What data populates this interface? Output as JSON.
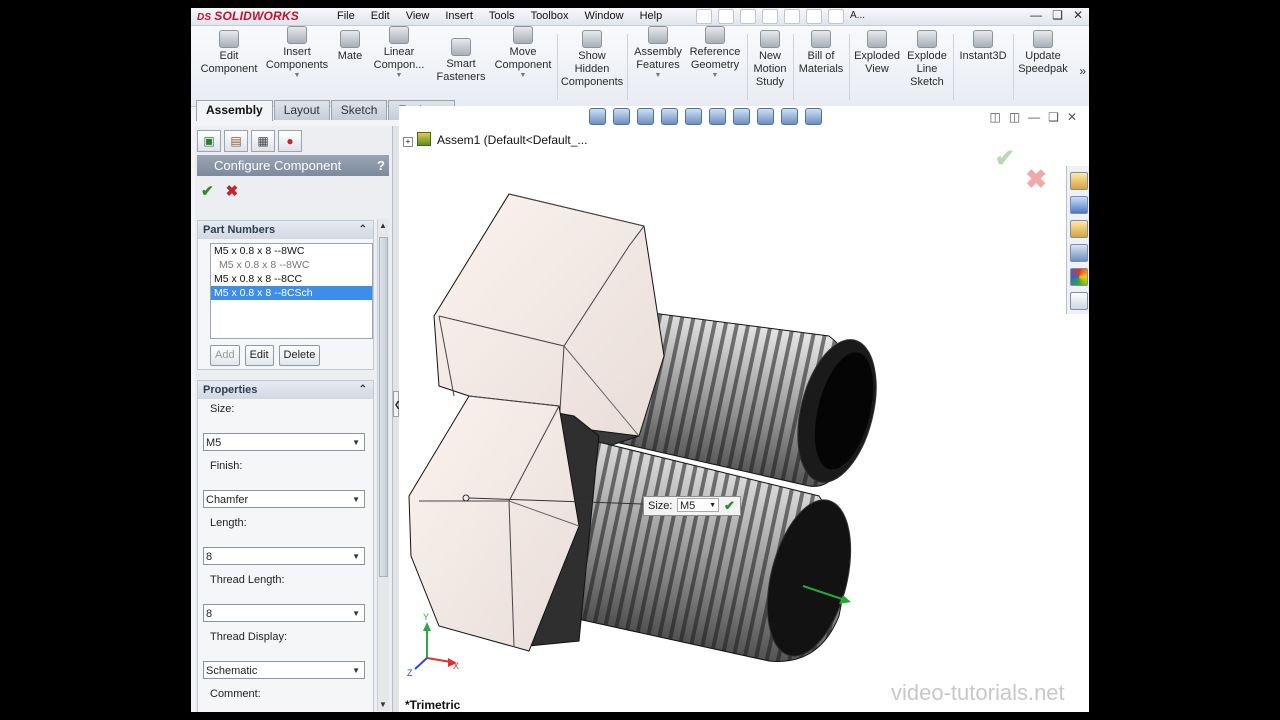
{
  "app": {
    "brand_prefix": "DS",
    "brand": "SOLIDWORKS"
  },
  "menu": [
    "File",
    "Edit",
    "View",
    "Insert",
    "Tools",
    "Toolbox",
    "Window",
    "Help"
  ],
  "search_hint": "A...",
  "commands": [
    {
      "l1": "Edit",
      "l2": "Component"
    },
    {
      "l1": "Insert",
      "l2": "Components"
    },
    {
      "l1": "Mate",
      "l2": ""
    },
    {
      "l1": "Linear",
      "l2": "Compon..."
    },
    {
      "l1": "Smart",
      "l2": "Fasteners"
    },
    {
      "l1": "Move",
      "l2": "Component"
    },
    {
      "l1": "Show",
      "l2": "Hidden",
      "l3": "Components"
    },
    {
      "l1": "Assembly",
      "l2": "Features"
    },
    {
      "l1": "Reference",
      "l2": "Geometry"
    },
    {
      "l1": "New",
      "l2": "Motion",
      "l3": "Study"
    },
    {
      "l1": "Bill of",
      "l2": "Materials"
    },
    {
      "l1": "Exploded",
      "l2": "View"
    },
    {
      "l1": "Explode",
      "l2": "Line",
      "l3": "Sketch"
    },
    {
      "l1": "Instant3D",
      "l2": ""
    },
    {
      "l1": "Update",
      "l2": "Speedpak"
    }
  ],
  "tabs": [
    "Assembly",
    "Layout",
    "Sketch",
    "Evaluate"
  ],
  "panel": {
    "title": "Configure Component",
    "help": "?",
    "part_numbers": {
      "header": "Part Numbers",
      "items": [
        "M5 x 0.8 x 8 --8WC",
        "M5 x 0.8 x 8 --8WC",
        "M5 x 0.8 x 8 --8CC",
        "M5 x 0.8 x 8 --8CSch"
      ],
      "buttons": {
        "add": "Add",
        "edit": "Edit",
        "delete": "Delete"
      }
    },
    "properties": {
      "header": "Properties",
      "size_label": "Size:",
      "size_value": "M5",
      "finish_label": "Finish:",
      "finish_value": "Chamfer",
      "length_label": "Length:",
      "length_value": "8",
      "thread_length_label": "Thread Length:",
      "thread_length_value": "8",
      "thread_display_label": "Thread Display:",
      "thread_display_value": "Schematic",
      "comment_label": "Comment:"
    }
  },
  "viewport": {
    "tree_label": "Assem1  (Default<Default_...",
    "callout_label": "Size:",
    "callout_value": "M5",
    "view_name": "*Trimetric",
    "triad": {
      "x": "X",
      "y": "Y",
      "z": "Z"
    }
  },
  "watermark": "video-tutorials.net",
  "colors": {
    "accent": "#3d8ee8",
    "ok": "#2e8b2e",
    "cancel": "#c0282e",
    "panel_header": "#8390a2"
  }
}
